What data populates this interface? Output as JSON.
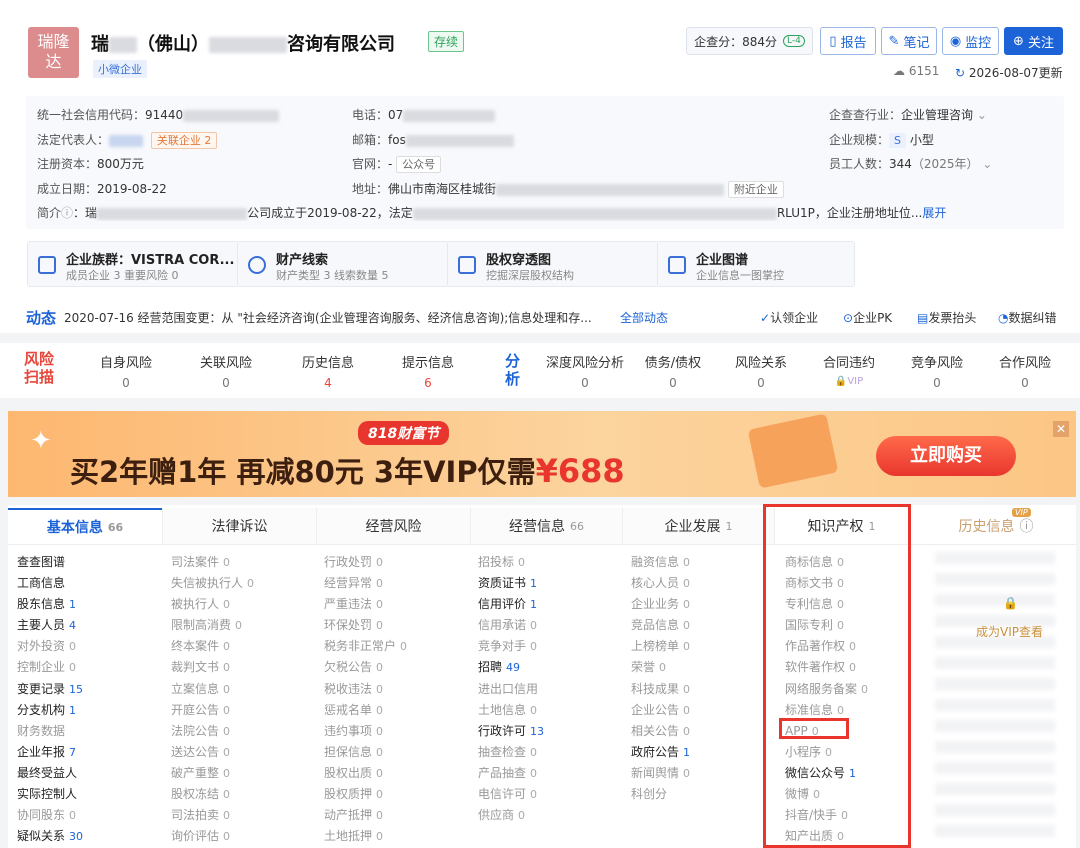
{
  "header": {
    "logo_text": "瑞隆\n达",
    "name_prefix": "瑞",
    "name_paren": "（佛山）",
    "name_suffix": "咨询有限公司",
    "status": "存续",
    "tag": "小微企业",
    "score_label": "企查分：884分",
    "score_badge": "L-4",
    "buttons": [
      "报告",
      "笔记",
      "监控",
      "关注"
    ],
    "views": "6151",
    "updated": "2026-08-07更新"
  },
  "info": {
    "credit_label": "统一社会信用代码：",
    "credit_value": "91440",
    "legal_label": "法定代表人：",
    "related": "关联企业",
    "related_count": "2",
    "capital_label": "注册资本：",
    "capital_value": "800万元",
    "date_label": "成立日期：",
    "date_value": "2019-08-22",
    "phone_label": "电话：",
    "phone_value": "07",
    "email_label": "邮箱：",
    "email_value": "fos",
    "web_label": "官网：",
    "web_value": "-",
    "web_tag": "公众号",
    "addr_label": "地址：",
    "addr_value": "佛山市南海区桂城街",
    "addr_tag": "附近企业",
    "industry_label": "企查查行业：",
    "industry_value": "企业管理咨询",
    "scale_label": "企业规模：",
    "scale_badge": "S",
    "scale_value": "小型",
    "staff_label": "员工人数：",
    "staff_value": "344",
    "staff_year": "（2025年）",
    "intro_label": "简介",
    "intro_a": "瑞",
    "intro_b": "公司成立于2019-08-22，法定",
    "intro_c": "RLU1P，企业注册地址位...",
    "intro_more": "展开"
  },
  "quick": [
    {
      "title": "企业族群：VISTRA COR...",
      "sub": "成员企业 3  重要风险 0"
    },
    {
      "title": "财产线索",
      "sub": "财产类型 3  线索数量 5"
    },
    {
      "title": "股权穿透图",
      "sub": "挖掘深层股权结构"
    },
    {
      "title": "企业图谱",
      "sub": "企业信息一图掌控"
    }
  ],
  "dynamic": {
    "label": "动态",
    "text": "2020-07-16 经营范围变更：从 \"社会经济咨询(企业管理咨询服务、经济信息咨询);信息处理和存...",
    "all": "全部动态",
    "actions": [
      "认领企业",
      "企业PK",
      "发票抬头",
      "数据纠错"
    ]
  },
  "risk": {
    "label": "风险\n扫描",
    "items": [
      {
        "name": "自身风险",
        "n": "0"
      },
      {
        "name": "关联风险",
        "n": "0"
      },
      {
        "name": "历史信息",
        "n": "4"
      },
      {
        "name": "提示信息",
        "n": "6"
      }
    ],
    "analysis_label": "分\n析",
    "analysis": [
      {
        "name": "深度风险分析",
        "n": "0"
      },
      {
        "name": "债务/债权",
        "n": "0"
      },
      {
        "name": "风险关系",
        "n": "0"
      },
      {
        "name": "合同违约",
        "n": "VIP"
      },
      {
        "name": "竞争风险",
        "n": "0"
      },
      {
        "name": "合作风险",
        "n": "0"
      }
    ]
  },
  "banner": {
    "badge": "818财富节",
    "text": "买2年赠1年 再减80元 3年VIP仅需",
    "price": "¥688",
    "cta": "立即购买"
  },
  "tabs": [
    {
      "label": "基本信息",
      "count": "66"
    },
    {
      "label": "法律诉讼",
      "count": ""
    },
    {
      "label": "经营风险",
      "count": ""
    },
    {
      "label": "经营信息",
      "count": "66"
    },
    {
      "label": "企业发展",
      "count": "1"
    },
    {
      "label": "知识产权",
      "count": "1"
    },
    {
      "label": "历史信息",
      "count": ""
    }
  ],
  "vip_text": "成为VIP查看",
  "cols": [
    [
      [
        "查查图谱",
        "",
        1
      ],
      [
        "工商信息",
        "",
        1
      ],
      [
        "股东信息",
        "1",
        1
      ],
      [
        "主要人员",
        "4",
        1
      ],
      [
        "对外投资",
        "0",
        0
      ],
      [
        "控制企业",
        "0",
        0
      ],
      [
        "变更记录",
        "15",
        1
      ],
      [
        "分支机构",
        "1",
        1
      ],
      [
        "财务数据",
        "",
        0
      ],
      [
        "企业年报",
        "7",
        1
      ],
      [
        "最终受益人",
        "",
        1
      ],
      [
        "实际控制人",
        "",
        1
      ],
      [
        "协同股东",
        "0",
        0
      ],
      [
        "疑似关系",
        "30",
        1
      ]
    ],
    [
      [
        "司法案件",
        "0",
        0
      ],
      [
        "失信被执行人",
        "0",
        0
      ],
      [
        "被执行人",
        "0",
        0
      ],
      [
        "限制高消费",
        "0",
        0
      ],
      [
        "终本案件",
        "0",
        0
      ],
      [
        "裁判文书",
        "0",
        0
      ],
      [
        "立案信息",
        "0",
        0
      ],
      [
        "开庭公告",
        "0",
        0
      ],
      [
        "法院公告",
        "0",
        0
      ],
      [
        "送达公告",
        "0",
        0
      ],
      [
        "破产重整",
        "0",
        0
      ],
      [
        "股权冻结",
        "0",
        0
      ],
      [
        "司法拍卖",
        "0",
        0
      ],
      [
        "询价评估",
        "0",
        0
      ]
    ],
    [
      [
        "行政处罚",
        "0",
        0
      ],
      [
        "经营异常",
        "0",
        0
      ],
      [
        "严重违法",
        "0",
        0
      ],
      [
        "环保处罚",
        "0",
        0
      ],
      [
        "税务非正常户",
        "0",
        0
      ],
      [
        "欠税公告",
        "0",
        0
      ],
      [
        "税收违法",
        "0",
        0
      ],
      [
        "惩戒名单",
        "0",
        0
      ],
      [
        "违约事项",
        "0",
        0
      ],
      [
        "担保信息",
        "0",
        0
      ],
      [
        "股权出质",
        "0",
        0
      ],
      [
        "股权质押",
        "0",
        0
      ],
      [
        "动产抵押",
        "0",
        0
      ],
      [
        "土地抵押",
        "0",
        0
      ]
    ],
    [
      [
        "招投标",
        "0",
        0
      ],
      [
        "资质证书",
        "1",
        1
      ],
      [
        "信用评价",
        "1",
        1
      ],
      [
        "信用承诺",
        "0",
        0
      ],
      [
        "竞争对手",
        "0",
        0
      ],
      [
        "招聘",
        "49",
        1
      ],
      [
        "进出口信用",
        "",
        0
      ],
      [
        "土地信息",
        "0",
        0
      ],
      [
        "行政许可",
        "13",
        1
      ],
      [
        "抽查检查",
        "0",
        0
      ],
      [
        "产品抽查",
        "0",
        0
      ],
      [
        "电信许可",
        "0",
        0
      ],
      [
        "供应商",
        "0",
        0
      ]
    ],
    [
      [
        "融资信息",
        "0",
        0
      ],
      [
        "核心人员",
        "0",
        0
      ],
      [
        "企业业务",
        "0",
        0
      ],
      [
        "竞品信息",
        "0",
        0
      ],
      [
        "上榜榜单",
        "0",
        0
      ],
      [
        "荣誉",
        "0",
        0
      ],
      [
        "科技成果",
        "0",
        0
      ],
      [
        "企业公告",
        "0",
        0
      ],
      [
        "相关公告",
        "0",
        0
      ],
      [
        "政府公告",
        "1",
        1
      ],
      [
        "新闻舆情",
        "0",
        0
      ],
      [
        "科创分",
        "",
        0
      ]
    ],
    [
      [
        "商标信息",
        "0",
        0
      ],
      [
        "商标文书",
        "0",
        0
      ],
      [
        "专利信息",
        "0",
        0
      ],
      [
        "国际专利",
        "0",
        0
      ],
      [
        "作品著作权",
        "0",
        0
      ],
      [
        "软件著作权",
        "0",
        0
      ],
      [
        "网络服务备案",
        "0",
        0
      ],
      [
        "标准信息",
        "0",
        0
      ],
      [
        "APP",
        "0",
        0
      ],
      [
        "小程序",
        "0",
        0
      ],
      [
        "微信公众号",
        "1",
        1
      ],
      [
        "微博",
        "0",
        0
      ],
      [
        "抖音/快手",
        "0",
        0
      ],
      [
        "知产出质",
        "0",
        0
      ]
    ]
  ]
}
